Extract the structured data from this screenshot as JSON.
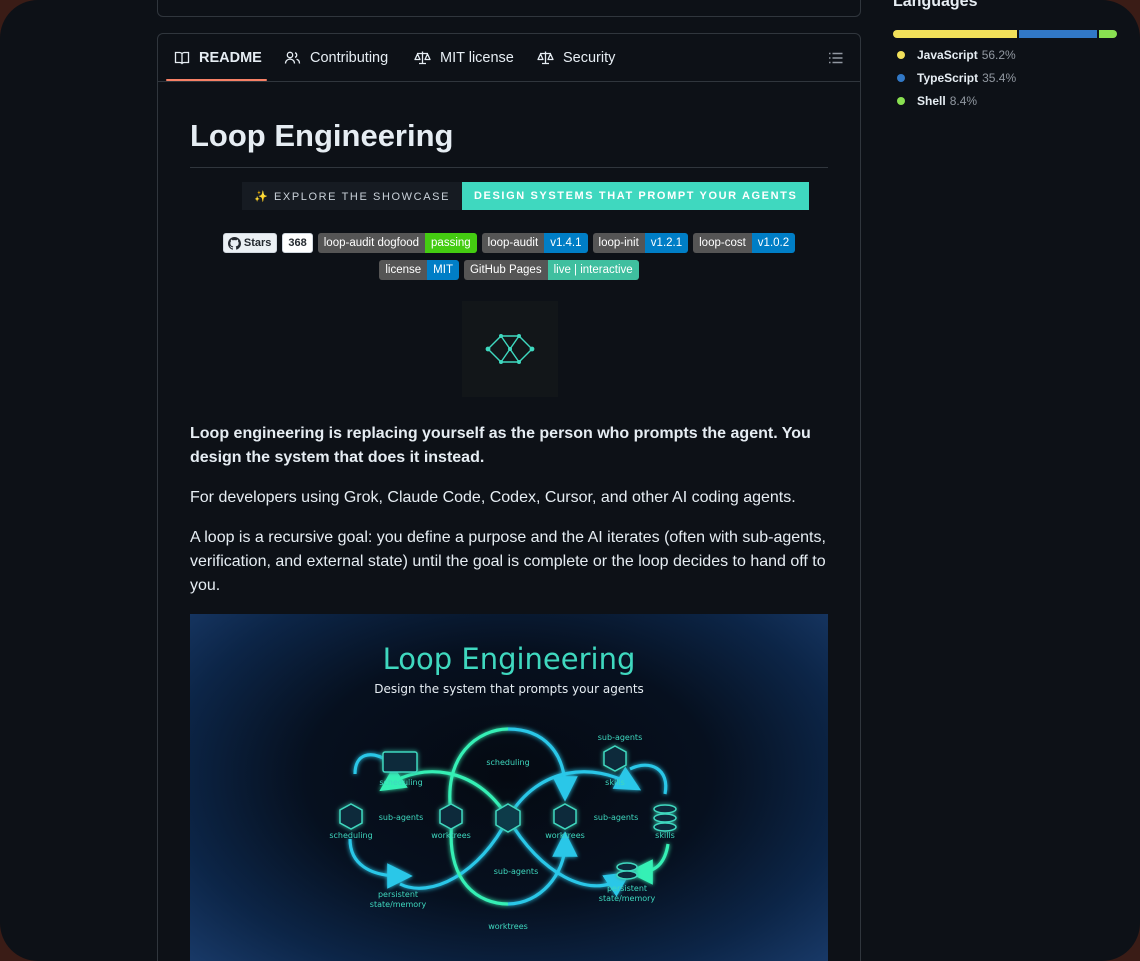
{
  "tabs": [
    {
      "label": "README",
      "active": true,
      "icon": "book-icon"
    },
    {
      "label": "Contributing",
      "icon": "people-icon"
    },
    {
      "label": "MIT license",
      "icon": "law-icon"
    },
    {
      "label": "Security",
      "icon": "law-icon"
    }
  ],
  "readme": {
    "title": "Loop Engineering",
    "showcase_left": "✨ EXPLORE THE SHOWCASE",
    "showcase_right": "DESIGN SYSTEMS THAT PROMPT YOUR AGENTS",
    "stars_label": "Stars",
    "stars_count": "368",
    "badges_row1": [
      {
        "label": "loop-audit dogfood",
        "value": "passing",
        "color": "#4c1"
      },
      {
        "label": "loop-audit",
        "value": "v1.4.1",
        "color": "#007ec6"
      },
      {
        "label": "loop-init",
        "value": "v1.2.1",
        "color": "#007ec6"
      },
      {
        "label": "loop-cost",
        "value": "v1.0.2",
        "color": "#007ec6"
      }
    ],
    "badges_row2": [
      {
        "label": "license",
        "value": "MIT",
        "color": "#007ec6"
      },
      {
        "label": "GitHub Pages",
        "value": "live | interactive",
        "color": "#3fbf9f"
      }
    ],
    "intro_bold": "Loop engineering is replacing yourself as the person who prompts the agent. You design the system that does it instead.",
    "para1": "For developers using Grok, Claude Code, Codex, Cursor, and other AI coding agents.",
    "para2": "A loop is a recursive goal: you define a purpose and the AI iterates (often with sub-agents, verification, and external state) until the goal is complete or the loop decides to hand off to you.",
    "banner": {
      "title": "Loop Engineering",
      "subtitle": "Design the system that prompts your agents",
      "labels": {
        "scheduling_a": "scheduling",
        "scheduling_b": "scheduling",
        "scheduling_c": "scheduling",
        "subagents_a": "sub-agents",
        "subagents_b": "sub-agents",
        "subagents_c": "sub-agents",
        "subagents_d": "sub-agents",
        "skills_a": "skills",
        "skills_b": "skills",
        "worktrees_a": "worktrees",
        "worktrees_b": "worktrees",
        "worktrees_c": "worktrees",
        "persistent_a": "persistent",
        "state_a": "state/memory",
        "persistent_b": "persistent",
        "state_b": "state/memory"
      }
    }
  },
  "sidebar": {
    "languages_title": "Languages",
    "languages": [
      {
        "name": "JavaScript",
        "pct": "56.2%",
        "value": 56.2,
        "color": "#f1e05a"
      },
      {
        "name": "TypeScript",
        "pct": "35.4%",
        "value": 35.4,
        "color": "#3178c6"
      },
      {
        "name": "Shell",
        "pct": "8.4%",
        "value": 8.4,
        "color": "#89e051"
      }
    ]
  }
}
